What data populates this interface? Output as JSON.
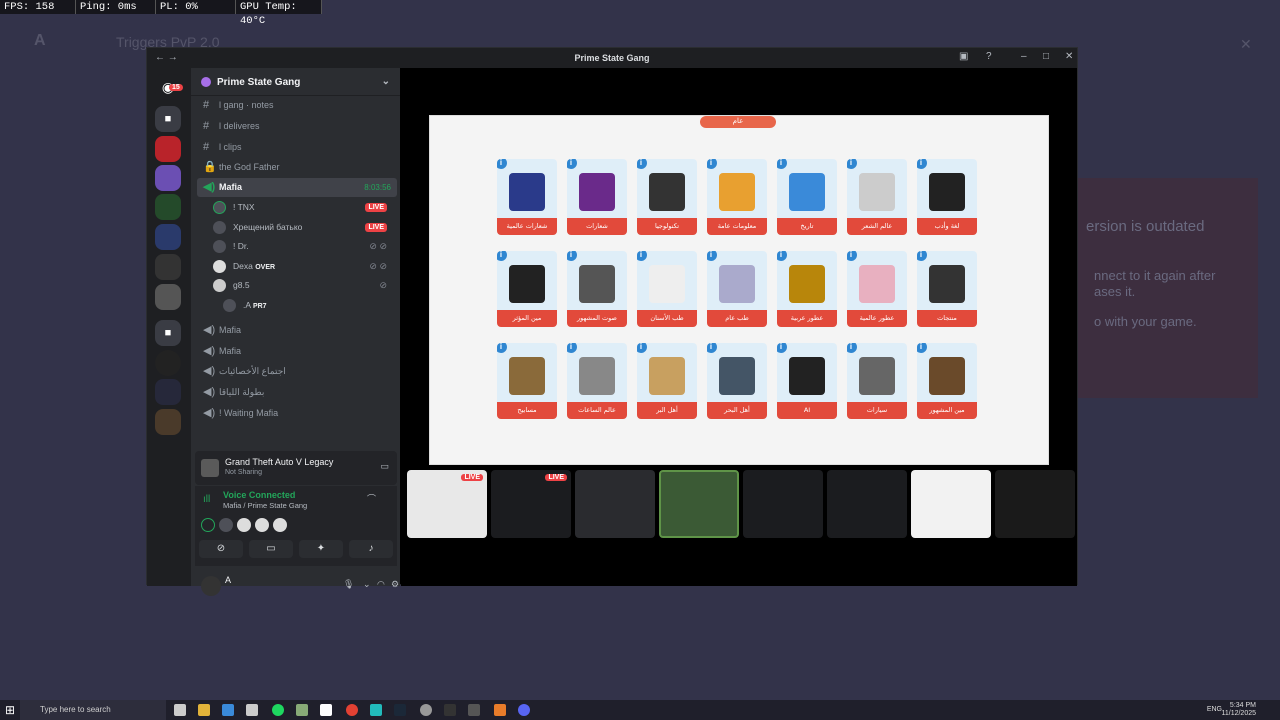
{
  "hud": {
    "fps": "FPS: 158",
    "ping": "Ping: 0ms",
    "pl": "PL: 0%",
    "gpu": "GPU Temp: 40°C"
  },
  "background": {
    "title": "Triggers PvP 2.0",
    "msg1": "ersion is outdated",
    "msg2": "nnect to it again after",
    "msg3": "ases it.",
    "msg4": "o with your game."
  },
  "window": {
    "title": "Prime State Gang"
  },
  "server": {
    "name": "Prime State Gang",
    "badge": "15"
  },
  "channels": [
    {
      "name": "l gang · notes"
    },
    {
      "name": "l deliveres"
    },
    {
      "name": "l clips"
    },
    {
      "name": "the God Father"
    }
  ],
  "active_channel": {
    "name": "Mafia",
    "time": "8:03:56"
  },
  "members": [
    {
      "name": "! TNX",
      "live": "LIVE"
    },
    {
      "name": "Хрещений батько",
      "live": "LIVE"
    },
    {
      "name": "! Dr."
    },
    {
      "name": "Dexa",
      "tag": "OVER"
    },
    {
      "name": "g8.5"
    },
    {
      "name": ".A",
      "tag": "PR7"
    }
  ],
  "channels2": [
    {
      "name": "Mafia"
    },
    {
      "name": "Mafia"
    },
    {
      "name": "اجتماع الأخصائيات"
    },
    {
      "name": "بطولة اللياقا"
    },
    {
      "name": "! Waiting Mafia"
    }
  ],
  "game": {
    "title": "Grand Theft Auto V Legacy",
    "status": "Not Sharing"
  },
  "voice": {
    "status": "Voice Connected",
    "channel": "Mafia / Prime State Gang"
  },
  "user": {
    "name": "A"
  },
  "slide": {
    "header": "عام",
    "cards": [
      "شعارات عالمية",
      "شعارات",
      "تكنولوجيا",
      "معلومات عامة",
      "تاريخ",
      "عالم الشعر",
      "لغة وأدب",
      "مين المؤثر",
      "صوت المشهور",
      "طب الأسنان",
      "طب عام",
      "عطور عربية",
      "عطور عالمية",
      "منتجات",
      "مسابيح",
      "عالم الساعات",
      "أهل البر",
      "أهل البحر",
      "AI",
      "سيارات",
      "مين المشهور"
    ]
  },
  "thumbs": {
    "live1": "LIVE",
    "live2": "LIVE"
  },
  "taskbar": {
    "search": "Type here to search",
    "lang": "ENG",
    "time": "5:34 PM",
    "date": "11/12/2025"
  }
}
